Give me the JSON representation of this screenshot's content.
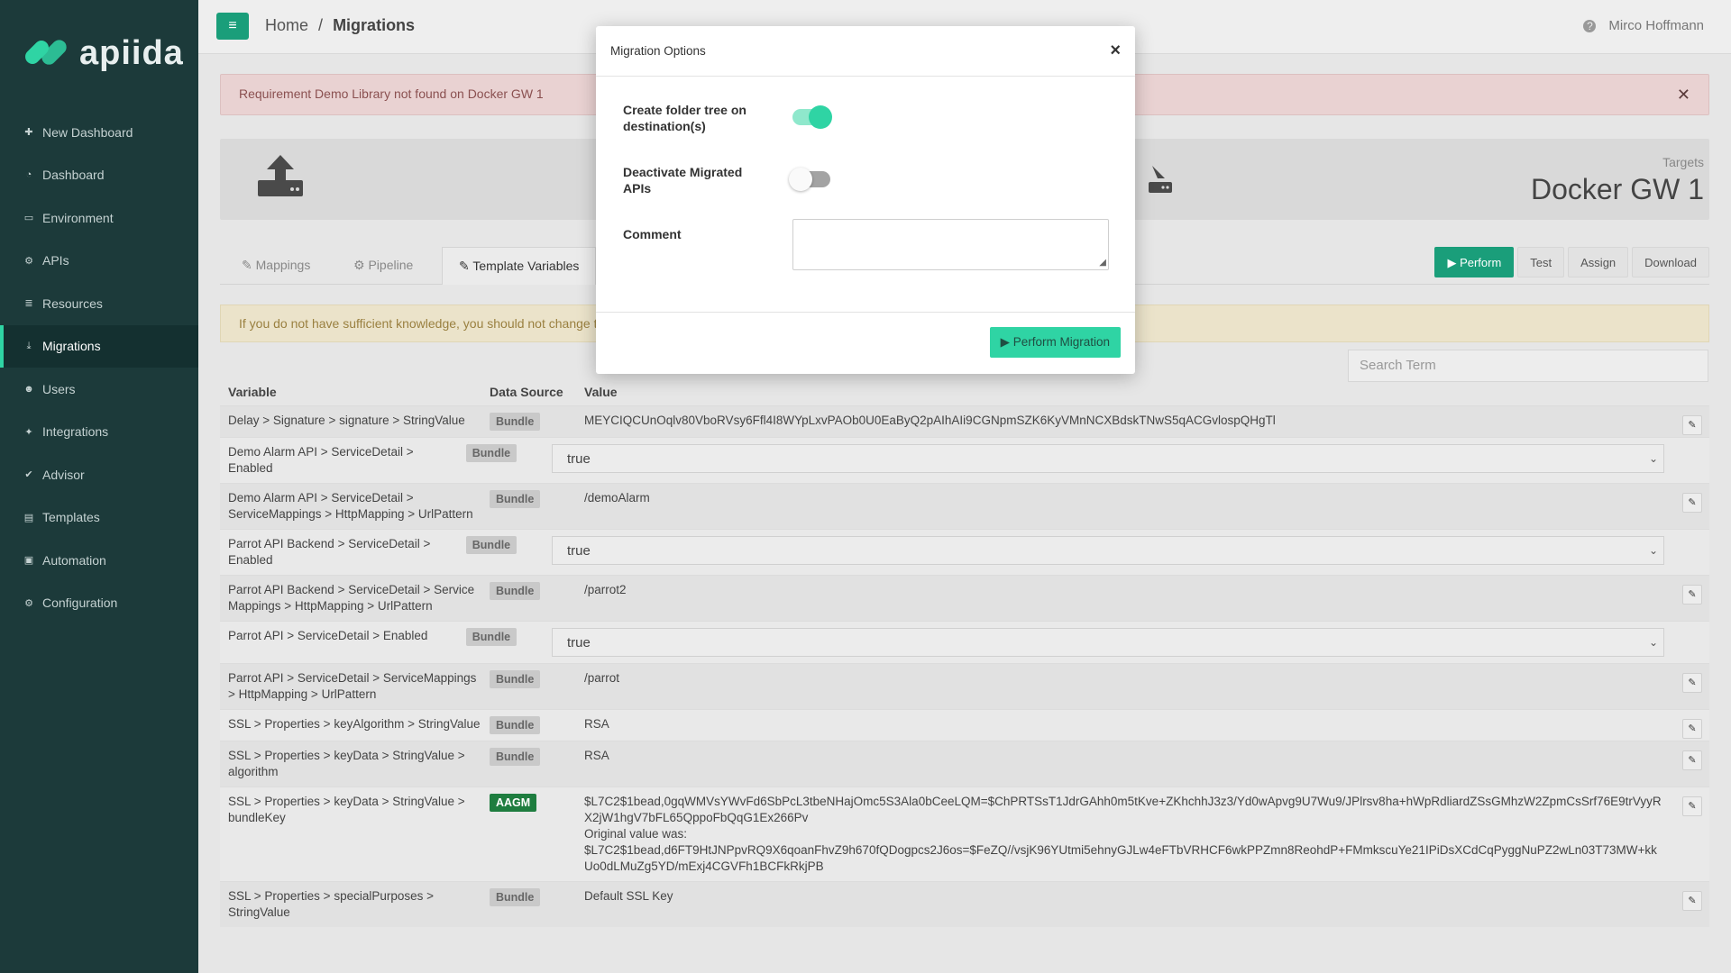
{
  "app": {
    "logo_text": "apiida"
  },
  "sidebar": {
    "items": [
      {
        "label": "New Dashboard",
        "icon": "plus-icon",
        "glyph": "✚"
      },
      {
        "label": "Dashboard",
        "icon": "dashboard-icon",
        "glyph": "◔"
      },
      {
        "label": "Environment",
        "icon": "monitor-icon",
        "glyph": "▭"
      },
      {
        "label": "APIs",
        "icon": "cogs-icon",
        "glyph": "⚙"
      },
      {
        "label": "Resources",
        "icon": "database-icon",
        "glyph": "≣"
      },
      {
        "label": "Migrations",
        "icon": "download-icon",
        "glyph": "⤓",
        "active": true
      },
      {
        "label": "Users",
        "icon": "users-icon",
        "glyph": "☻"
      },
      {
        "label": "Integrations",
        "icon": "puzzle-icon",
        "glyph": "✦"
      },
      {
        "label": "Advisor",
        "icon": "check-icon",
        "glyph": "✔"
      },
      {
        "label": "Templates",
        "icon": "file-icon",
        "glyph": "▤"
      },
      {
        "label": "Automation",
        "icon": "inbox-icon",
        "glyph": "▣"
      },
      {
        "label": "Configuration",
        "icon": "gear-icon",
        "glyph": "⚙"
      }
    ]
  },
  "topbar": {
    "breadcrumb_home": "Home",
    "breadcrumb_sep": "/",
    "breadcrumb_current": "Migrations",
    "user_name": "Mirco Hoffmann"
  },
  "alert": {
    "text": "Requirement Demo Library not found on Docker GW 1"
  },
  "info": {
    "targets_label": "Targets",
    "target_name": "Docker GW 1"
  },
  "tabs": [
    "Mappings",
    "Pipeline",
    "Template Variables"
  ],
  "actions": {
    "perform": "▶ Perform",
    "test": "Test",
    "assign": "Assign",
    "download": "Download"
  },
  "warning": {
    "text": "If you do not have sufficient knowledge, you should not change th"
  },
  "search": {
    "placeholder": "Search Term"
  },
  "table": {
    "headers": [
      "Variable",
      "Data Source",
      "Value"
    ],
    "rows": [
      {
        "variable": "Delay > Signature > signature > StringValue",
        "source": "Bundle",
        "value": "MEYCIQCUnOqlv80VboRVsy6Ffl4I8WYpLxvPAOb0U0EaByQ2pAIhAIi9CGNpmSZK6KyVMnNCXBdskTNwS5qACGvlospQHgTl"
      },
      {
        "variable": "Demo Alarm API > ServiceDetail > Enabled",
        "source": "Bundle",
        "value": "true",
        "select": true
      },
      {
        "variable": "Demo Alarm API > ServiceDetail > ServiceMappings > HttpMapping > UrlPattern",
        "source": "Bundle",
        "value": "/demoAlarm"
      },
      {
        "variable": "Parrot API Backend > ServiceDetail > Enabled",
        "source": "Bundle",
        "value": "true",
        "select": true
      },
      {
        "variable": "Parrot API Backend > ServiceDetail > Service Mappings > HttpMapping > UrlPattern",
        "source": "Bundle",
        "value": "/parrot2"
      },
      {
        "variable": "Parrot API > ServiceDetail > Enabled",
        "source": "Bundle",
        "value": "true",
        "select": true
      },
      {
        "variable": "Parrot API > ServiceDetail > ServiceMappings > HttpMapping > UrlPattern",
        "source": "Bundle",
        "value": "/parrot"
      },
      {
        "variable": "SSL > Properties > keyAlgorithm > StringValue",
        "source": "Bundle",
        "value": "RSA"
      },
      {
        "variable": "SSL > Properties > keyData > StringValue > algorithm",
        "source": "Bundle",
        "value": "RSA"
      },
      {
        "variable": "SSL > Properties > keyData > StringValue > bundleKey",
        "source": "AAGM",
        "value": "$L7C2$1bead,0gqWMVsYWvFd6SbPcL3tbeNHajOmc5S3Ala0bCeeLQM=$ChPRTSsT1JdrGAhh0m5tKve+ZKhchhJ3z3/Yd0wApvg9U7Wu9/JPlrsv8ha+hWpRdliardZSsGMhzW2ZpmCsSrf76E9trVyyRX2jW1hgV7bFL65QppoFbQqG1Ex266Pv",
        "original_label": "Original value was:",
        "original_value": "$L7C2$1bead,d6FT9HtJNPpvRQ9X6qoanFhvZ9h670fQDogpcs2J6os=$FeZQ//vsjK96YUtmi5ehnyGJLw4eFTbVRHCF6wkPPZmn8ReohdP+FMmkscuYe21IPiDsXCdCqPyggNuPZ2wLn03T73MW+kkUo0dLMuZg5YD/mExj4CGVFh1BCFkRkjPB"
      },
      {
        "variable": "SSL > Properties > specialPurposes > StringValue",
        "source": "Bundle",
        "value": "Default SSL Key"
      }
    ]
  },
  "modal": {
    "title": "Migration Options",
    "create_folder_label": "Create folder tree on destination(s)",
    "create_folder_on": true,
    "deactivate_label": "Deactivate Migrated APIs",
    "deactivate_on": false,
    "comment_label": "Comment",
    "comment_value": "",
    "submit_label": "▶ Perform Migration"
  }
}
